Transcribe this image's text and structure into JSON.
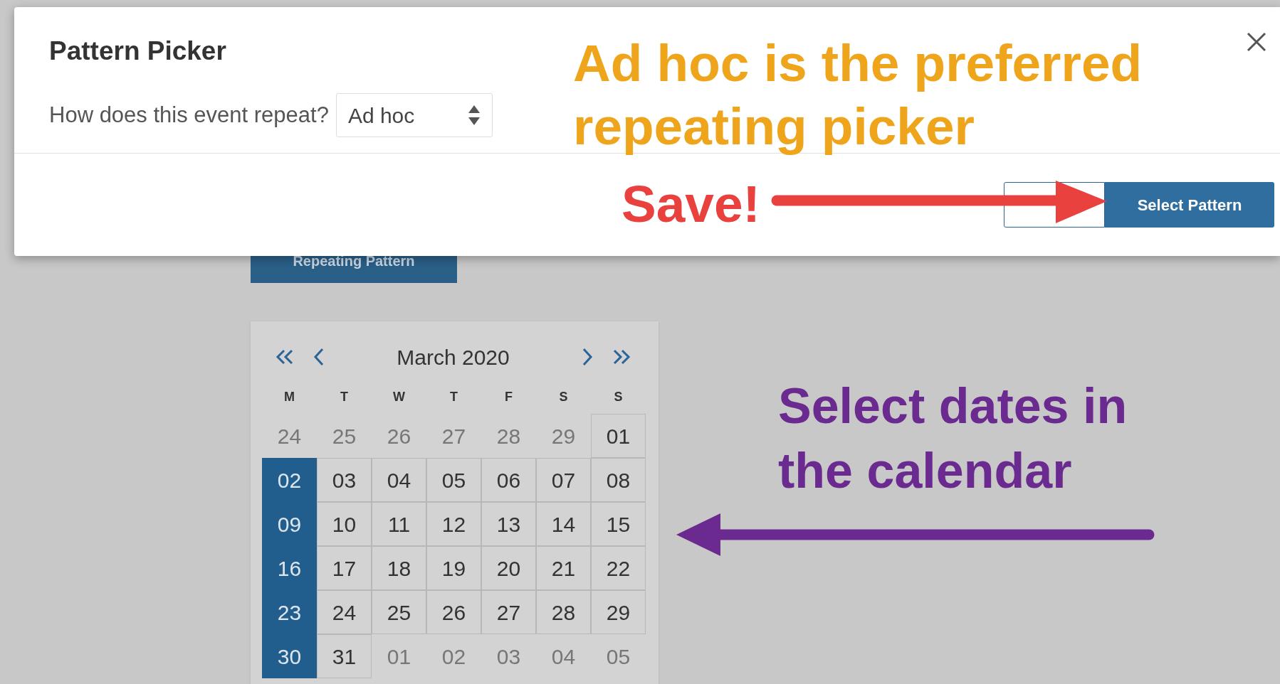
{
  "dialog": {
    "title": "Pattern Picker",
    "repeat_label": "How does this event repeat?",
    "repeat_select": {
      "value": "Ad hoc"
    },
    "primary_button": "Select Pattern"
  },
  "background": {
    "button": "Repeating Pattern",
    "calendar": {
      "month": "March 2020",
      "weekdays": [
        "M",
        "T",
        "W",
        "T",
        "F",
        "S",
        "S"
      ],
      "weeks": [
        [
          {
            "day": "24",
            "other_month": true,
            "selected": false
          },
          {
            "day": "25",
            "other_month": true,
            "selected": false
          },
          {
            "day": "26",
            "other_month": true,
            "selected": false
          },
          {
            "day": "27",
            "other_month": true,
            "selected": false
          },
          {
            "day": "28",
            "other_month": true,
            "selected": false
          },
          {
            "day": "29",
            "other_month": true,
            "selected": false
          },
          {
            "day": "01",
            "other_month": false,
            "selected": false
          }
        ],
        [
          {
            "day": "02",
            "other_month": false,
            "selected": true
          },
          {
            "day": "03",
            "other_month": false,
            "selected": false
          },
          {
            "day": "04",
            "other_month": false,
            "selected": false
          },
          {
            "day": "05",
            "other_month": false,
            "selected": false
          },
          {
            "day": "06",
            "other_month": false,
            "selected": false
          },
          {
            "day": "07",
            "other_month": false,
            "selected": false
          },
          {
            "day": "08",
            "other_month": false,
            "selected": false
          }
        ],
        [
          {
            "day": "09",
            "other_month": false,
            "selected": true
          },
          {
            "day": "10",
            "other_month": false,
            "selected": false
          },
          {
            "day": "11",
            "other_month": false,
            "selected": false
          },
          {
            "day": "12",
            "other_month": false,
            "selected": false
          },
          {
            "day": "13",
            "other_month": false,
            "selected": false
          },
          {
            "day": "14",
            "other_month": false,
            "selected": false
          },
          {
            "day": "15",
            "other_month": false,
            "selected": false
          }
        ],
        [
          {
            "day": "16",
            "other_month": false,
            "selected": true
          },
          {
            "day": "17",
            "other_month": false,
            "selected": false
          },
          {
            "day": "18",
            "other_month": false,
            "selected": false
          },
          {
            "day": "19",
            "other_month": false,
            "selected": false
          },
          {
            "day": "20",
            "other_month": false,
            "selected": false
          },
          {
            "day": "21",
            "other_month": false,
            "selected": false
          },
          {
            "day": "22",
            "other_month": false,
            "selected": false
          }
        ],
        [
          {
            "day": "23",
            "other_month": false,
            "selected": true
          },
          {
            "day": "24",
            "other_month": false,
            "selected": false
          },
          {
            "day": "25",
            "other_month": false,
            "selected": false
          },
          {
            "day": "26",
            "other_month": false,
            "selected": false
          },
          {
            "day": "27",
            "other_month": false,
            "selected": false
          },
          {
            "day": "28",
            "other_month": false,
            "selected": false
          },
          {
            "day": "29",
            "other_month": false,
            "selected": false
          }
        ],
        [
          {
            "day": "30",
            "other_month": false,
            "selected": true
          },
          {
            "day": "31",
            "other_month": false,
            "selected": false
          },
          {
            "day": "01",
            "other_month": true,
            "selected": false
          },
          {
            "day": "02",
            "other_month": true,
            "selected": false
          },
          {
            "day": "03",
            "other_month": true,
            "selected": false
          },
          {
            "day": "04",
            "other_month": true,
            "selected": false
          },
          {
            "day": "05",
            "other_month": true,
            "selected": false
          }
        ]
      ]
    }
  },
  "annotations": [
    {
      "text": "Ad hoc is the preferred repeating picker",
      "color": "#efa51b"
    },
    {
      "text": "Save!",
      "color": "#e8413e"
    },
    {
      "text": "Select dates in the calendar",
      "color": "#6b2a8f"
    }
  ]
}
